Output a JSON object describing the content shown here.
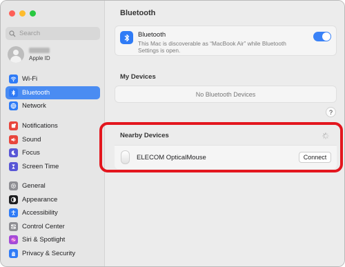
{
  "window": {
    "controls": [
      "close",
      "minimize",
      "zoom"
    ]
  },
  "sidebar": {
    "search_placeholder": "Search",
    "account": {
      "subtitle": "Apple ID"
    },
    "groups": [
      [
        {
          "label": "Wi-Fi",
          "icon": "wifi-icon",
          "color": "#2f7bf6",
          "active": false
        },
        {
          "label": "Bluetooth",
          "icon": "bluetooth-icon",
          "color": "#2f7bf6",
          "active": true
        },
        {
          "label": "Network",
          "icon": "globe-icon",
          "color": "#2f7bf6",
          "active": false
        }
      ],
      [
        {
          "label": "Notifications",
          "icon": "bell-icon",
          "color": "#e8453c",
          "active": false
        },
        {
          "label": "Sound",
          "icon": "speaker-icon",
          "color": "#e8453c",
          "active": false
        },
        {
          "label": "Focus",
          "icon": "moon-icon",
          "color": "#5856d6",
          "active": false
        },
        {
          "label": "Screen Time",
          "icon": "hourglass-icon",
          "color": "#5856d6",
          "active": false
        }
      ],
      [
        {
          "label": "General",
          "icon": "gear-icon",
          "color": "#8e8e93",
          "active": false
        },
        {
          "label": "Appearance",
          "icon": "appearance-icon",
          "color": "#1d1d1f",
          "active": false
        },
        {
          "label": "Accessibility",
          "icon": "accessibility-icon",
          "color": "#2f7bf6",
          "active": false
        },
        {
          "label": "Control Center",
          "icon": "control-center-icon",
          "color": "#8e8e93",
          "active": false
        },
        {
          "label": "Siri & Spotlight",
          "icon": "siri-icon",
          "color": "#a34ad8",
          "active": false
        },
        {
          "label": "Privacy & Security",
          "icon": "hand-icon",
          "color": "#2f7bf6",
          "active": false
        }
      ]
    ]
  },
  "main": {
    "title": "Bluetooth",
    "bluetooth": {
      "label": "Bluetooth",
      "description": "This Mac is discoverable as “MacBook Air” while Bluetooth Settings is open.",
      "enabled": true
    },
    "my_devices": {
      "title": "My Devices",
      "empty_text": "No Bluetooth Devices"
    },
    "help_label": "?",
    "nearby": {
      "title": "Nearby Devices",
      "devices": [
        {
          "name": "ELECOM OpticalMouse",
          "action": "Connect"
        }
      ]
    }
  },
  "annotation": {
    "color": "#e3161e"
  }
}
